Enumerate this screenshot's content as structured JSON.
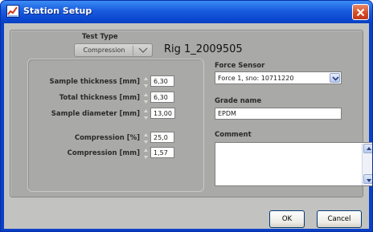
{
  "window": {
    "title": "Station Setup",
    "accent": "#0a46cf",
    "close_color": "#d24a22"
  },
  "test_type": {
    "label": "Test Type",
    "value": "Compression",
    "rig_name": "Rig 1_2009505"
  },
  "fields": [
    {
      "label": "Sample thickness [mm]",
      "value": "6,30"
    },
    {
      "label": "Total thickness [mm]",
      "value": "6,30"
    },
    {
      "label": "Sample diameter [mm]",
      "value": "13,00"
    },
    {
      "label": "Compression [%]",
      "value": "25,0"
    },
    {
      "label": "Compression [mm]",
      "value": "1,57"
    }
  ],
  "force_sensor": {
    "label": "Force Sensor",
    "value": "Force 1, sno: 10711220"
  },
  "grade": {
    "label": "Grade name",
    "value": "EPDM"
  },
  "comment": {
    "label": "Comment",
    "value": ""
  },
  "buttons": {
    "ok": "OK",
    "cancel": "Cancel"
  }
}
